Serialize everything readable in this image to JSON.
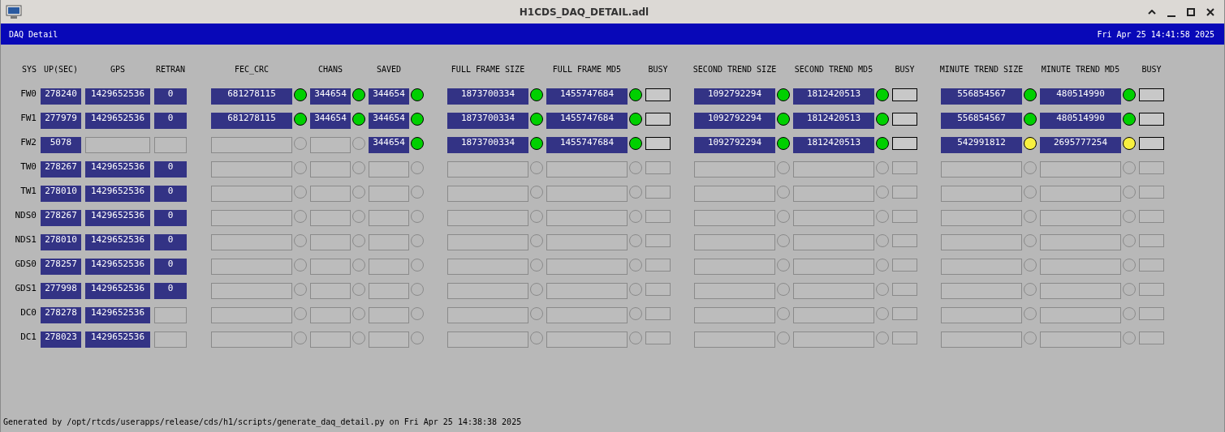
{
  "window": {
    "title": "H1CDS_DAQ_DETAIL.adl"
  },
  "header": {
    "title": "DAQ Detail",
    "datetime": "Fri Apr 25 14:41:58 2025"
  },
  "columns": [
    "SYS",
    "UP(SEC)",
    "GPS",
    "RETRAN",
    "FEC_CRC",
    "CHANS",
    "SAVED",
    "FULL FRAME SIZE",
    "FULL FRAME MD5",
    "BUSY",
    "SECOND TREND SIZE",
    "SECOND TREND MD5",
    "BUSY",
    "MINUTE TREND SIZE",
    "MINUTE TREND MD5",
    "BUSY"
  ],
  "rows": [
    {
      "sys": "FW0",
      "up": "278240",
      "gps": "1429652536",
      "retran": "0",
      "monitors": [
        {
          "value": "681278115",
          "lit": true,
          "color": "#00d000"
        },
        {
          "value": "344654",
          "lit": true,
          "color": "#00d000"
        },
        {
          "value": "344654",
          "lit": true,
          "color": "#00d000"
        },
        {
          "value": "1873700334",
          "lit": true,
          "color": "#00d000"
        },
        {
          "value": "1455747684",
          "lit": true,
          "color": "#00d000"
        },
        {
          "value": "1092792294",
          "lit": true,
          "color": "#00d000"
        },
        {
          "value": "1812420513",
          "lit": true,
          "color": "#00d000"
        },
        {
          "value": "556854567",
          "lit": true,
          "color": "#00d000"
        },
        {
          "value": "480514990",
          "lit": true,
          "color": "#00d000"
        }
      ],
      "busy": [
        {
          "connected": true
        },
        {
          "connected": true
        },
        {
          "connected": true
        }
      ]
    },
    {
      "sys": "FW1",
      "up": "277979",
      "gps": "1429652536",
      "retran": "0",
      "monitors": [
        {
          "value": "681278115",
          "lit": true,
          "color": "#00d000"
        },
        {
          "value": "344654",
          "lit": true,
          "color": "#00d000"
        },
        {
          "value": "344654",
          "lit": true,
          "color": "#00d000"
        },
        {
          "value": "1873700334",
          "lit": true,
          "color": "#00d000"
        },
        {
          "value": "1455747684",
          "lit": true,
          "color": "#00d000"
        },
        {
          "value": "1092792294",
          "lit": true,
          "color": "#00d000"
        },
        {
          "value": "1812420513",
          "lit": true,
          "color": "#00d000"
        },
        {
          "value": "556854567",
          "lit": true,
          "color": "#00d000"
        },
        {
          "value": "480514990",
          "lit": true,
          "color": "#00d000"
        }
      ],
      "busy": [
        {
          "connected": true
        },
        {
          "connected": true
        },
        {
          "connected": true
        }
      ]
    },
    {
      "sys": "FW2",
      "up": "5078",
      "monitors": [
        {
          "lit": false
        },
        {
          "lit": false
        },
        {
          "value": "344654",
          "lit": true,
          "color": "#00d000"
        },
        {
          "value": "1873700334",
          "lit": true,
          "color": "#00d000"
        },
        {
          "value": "1455747684",
          "lit": true,
          "color": "#00d000"
        },
        {
          "value": "1092792294",
          "lit": true,
          "color": "#00d000"
        },
        {
          "value": "1812420513",
          "lit": true,
          "color": "#00d000"
        },
        {
          "value": "542991812",
          "lit": true,
          "color": "#f8f040"
        },
        {
          "value": "2695777254",
          "lit": true,
          "color": "#f8f040"
        }
      ],
      "busy": [
        {
          "connected": true
        },
        {
          "connected": true
        },
        {
          "connected": true
        }
      ]
    },
    {
      "sys": "TW0",
      "up": "278267",
      "gps": "1429652536",
      "retran": "0",
      "monitors": [
        {
          "lit": false
        },
        {
          "lit": false
        },
        {
          "lit": false
        },
        {
          "lit": false
        },
        {
          "lit": false
        },
        {
          "lit": false
        },
        {
          "lit": false
        },
        {
          "lit": false
        },
        {
          "lit": false
        }
      ],
      "busy": [
        {
          "connected": false
        },
        {
          "connected": false
        },
        {
          "connected": false
        }
      ]
    },
    {
      "sys": "TW1",
      "up": "278010",
      "gps": "1429652536",
      "retran": "0",
      "monitors": [
        {
          "lit": false
        },
        {
          "lit": false
        },
        {
          "lit": false
        },
        {
          "lit": false
        },
        {
          "lit": false
        },
        {
          "lit": false
        },
        {
          "lit": false
        },
        {
          "lit": false
        },
        {
          "lit": false
        }
      ],
      "busy": [
        {
          "connected": false
        },
        {
          "connected": false
        },
        {
          "connected": false
        }
      ]
    },
    {
      "sys": "NDS0",
      "up": "278267",
      "gps": "1429652536",
      "retran": "0",
      "monitors": [
        {
          "lit": false
        },
        {
          "lit": false
        },
        {
          "lit": false
        },
        {
          "lit": false
        },
        {
          "lit": false
        },
        {
          "lit": false
        },
        {
          "lit": false
        },
        {
          "lit": false
        },
        {
          "lit": false
        }
      ],
      "busy": [
        {
          "connected": false
        },
        {
          "connected": false
        },
        {
          "connected": false
        }
      ]
    },
    {
      "sys": "NDS1",
      "up": "278010",
      "gps": "1429652536",
      "retran": "0",
      "monitors": [
        {
          "lit": false
        },
        {
          "lit": false
        },
        {
          "lit": false
        },
        {
          "lit": false
        },
        {
          "lit": false
        },
        {
          "lit": false
        },
        {
          "lit": false
        },
        {
          "lit": false
        },
        {
          "lit": false
        }
      ],
      "busy": [
        {
          "connected": false
        },
        {
          "connected": false
        },
        {
          "connected": false
        }
      ]
    },
    {
      "sys": "GDS0",
      "up": "278257",
      "gps": "1429652536",
      "retran": "0",
      "monitors": [
        {
          "lit": false
        },
        {
          "lit": false
        },
        {
          "lit": false
        },
        {
          "lit": false
        },
        {
          "lit": false
        },
        {
          "lit": false
        },
        {
          "lit": false
        },
        {
          "lit": false
        },
        {
          "lit": false
        }
      ],
      "busy": [
        {
          "connected": false
        },
        {
          "connected": false
        },
        {
          "connected": false
        }
      ]
    },
    {
      "sys": "GDS1",
      "up": "277998",
      "gps": "1429652536",
      "retran": "0",
      "monitors": [
        {
          "lit": false
        },
        {
          "lit": false
        },
        {
          "lit": false
        },
        {
          "lit": false
        },
        {
          "lit": false
        },
        {
          "lit": false
        },
        {
          "lit": false
        },
        {
          "lit": false
        },
        {
          "lit": false
        }
      ],
      "busy": [
        {
          "connected": false
        },
        {
          "connected": false
        },
        {
          "connected": false
        }
      ]
    },
    {
      "sys": "DC0",
      "up": "278278",
      "gps": "1429652536",
      "monitors": [
        {
          "lit": false
        },
        {
          "lit": false
        },
        {
          "lit": false
        },
        {
          "lit": false
        },
        {
          "lit": false
        },
        {
          "lit": false
        },
        {
          "lit": false
        },
        {
          "lit": false
        },
        {
          "lit": false
        }
      ],
      "busy": [
        {
          "connected": false
        },
        {
          "connected": false
        },
        {
          "connected": false
        }
      ]
    },
    {
      "sys": "DC1",
      "up": "278023",
      "gps": "1429652536",
      "monitors": [
        {
          "lit": false
        },
        {
          "lit": false
        },
        {
          "lit": false
        },
        {
          "lit": false
        },
        {
          "lit": false
        },
        {
          "lit": false
        },
        {
          "lit": false
        },
        {
          "lit": false
        },
        {
          "lit": false
        }
      ],
      "busy": [
        {
          "connected": false
        },
        {
          "connected": false
        },
        {
          "connected": false
        }
      ]
    }
  ],
  "footer": "Generated by /opt/rtcds/userapps/release/cds/h1/scripts/generate_daq_detail.py on Fri Apr 25 14:38:38 2025"
}
